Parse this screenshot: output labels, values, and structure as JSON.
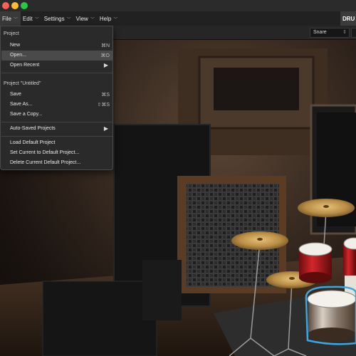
{
  "menubar": {
    "items": [
      {
        "label": "File",
        "open": true
      },
      {
        "label": "Edit"
      },
      {
        "label": "Settings"
      },
      {
        "label": "View"
      },
      {
        "label": "Help"
      }
    ],
    "brand_tab": "DRU"
  },
  "toolbar": {
    "instrument_select": {
      "value": "Snare"
    }
  },
  "file_menu": {
    "section_project": "Project",
    "new": {
      "label": "New",
      "shortcut": "⌘N"
    },
    "open": {
      "label": "Open...",
      "shortcut": "⌘O",
      "highlighted": true
    },
    "open_recent": {
      "label": "Open Recent"
    },
    "section_untitled": "Project \"Untitled\"",
    "save": {
      "label": "Save",
      "shortcut": "⌘S"
    },
    "save_as": {
      "label": "Save As...",
      "shortcut": "⇧⌘S"
    },
    "save_copy": {
      "label": "Save a Copy..."
    },
    "auto_saved": {
      "label": "Auto-Saved Projects"
    },
    "load_default": {
      "label": "Load Default Project"
    },
    "set_default": {
      "label": "Set Current to Default Project..."
    },
    "delete_default": {
      "label": "Delete Current Default Project..."
    }
  },
  "colors": {
    "menu_bg": "#2a2a2a",
    "highlight": "#4a4a4a",
    "selected_drum_outline": "#3aa8e0"
  }
}
